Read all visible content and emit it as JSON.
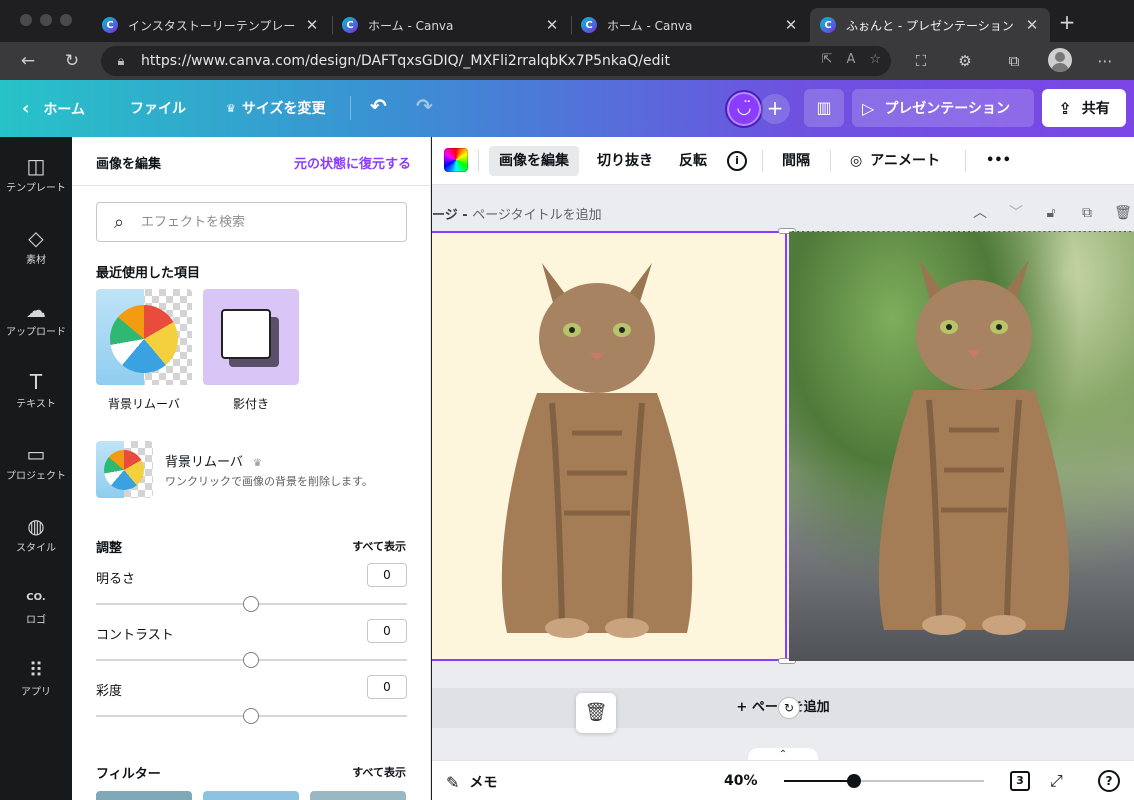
{
  "browser": {
    "tabs": [
      {
        "title": "インスタストーリーテンプレート ›",
        "active": false
      },
      {
        "title": "ホーム - Canva",
        "active": false
      },
      {
        "title": "ホーム - Canva",
        "active": false
      },
      {
        "title": "ふぉんと - プレゼンテーション",
        "active": true
      }
    ],
    "favicon_letter": "C",
    "close_glyph": "✕",
    "new_tab_glyph": "+",
    "url": "https://www.canva.com/design/DAFTqxsGDIQ/_MXFli2rralqbKx7P5nkaQ/edit"
  },
  "topbar": {
    "home": "ホーム",
    "file": "ファイル",
    "resize": "サイズを変更",
    "present": "プレゼンテーション",
    "share": "共有"
  },
  "rail": [
    {
      "label": "テンプレート",
      "icon": "template-icon",
      "glyph": "◫"
    },
    {
      "label": "素材",
      "icon": "elements-icon",
      "glyph": "◇"
    },
    {
      "label": "アップロード",
      "icon": "upload-icon",
      "glyph": "☁"
    },
    {
      "label": "テキスト",
      "icon": "text-icon",
      "glyph": "T"
    },
    {
      "label": "プロジェクト",
      "icon": "folder-icon",
      "glyph": "▭"
    },
    {
      "label": "スタイル",
      "icon": "palette-icon",
      "glyph": "◍"
    },
    {
      "label": "ロゴ",
      "icon": "logo-icon",
      "glyph": "CO."
    },
    {
      "label": "アプリ",
      "icon": "apps-icon",
      "glyph": "⠿"
    }
  ],
  "panel": {
    "title": "画像を編集",
    "reset": "元の状態に復元する",
    "search_placeholder": "エフェクトを検索",
    "recent_heading": "最近使用した項目",
    "recent": [
      {
        "label": "背景リムーバ"
      },
      {
        "label": "影付き"
      }
    ],
    "bg_remover": {
      "title": "背景リムーバ",
      "desc": "ワンクリックで画像の背景を削除します。"
    },
    "adjust_heading": "調整",
    "show_all": "すべて表示",
    "adjustments": [
      {
        "label": "明るさ",
        "value": "0"
      },
      {
        "label": "コントラスト",
        "value": "0"
      },
      {
        "label": "彩度",
        "value": "0"
      }
    ],
    "filter_heading": "フィルター",
    "filter_show_all": "すべて表示"
  },
  "context_toolbar": {
    "edit_image": "画像を編集",
    "crop": "切り抜き",
    "flip": "反転",
    "spacing": "間隔",
    "animate": "アニメート",
    "more": "•••"
  },
  "canvas": {
    "page_title_prefix": "ージ - ",
    "page_title": "ページタイトルを追加",
    "add_page": "+ ページを追加"
  },
  "footer": {
    "memo": "メモ",
    "zoom": "40%",
    "zoom_fraction": 0.35,
    "pages": "3"
  },
  "colors": {
    "accent": "#8b3dff",
    "canvas_bg_left": "#fdf6dc"
  }
}
